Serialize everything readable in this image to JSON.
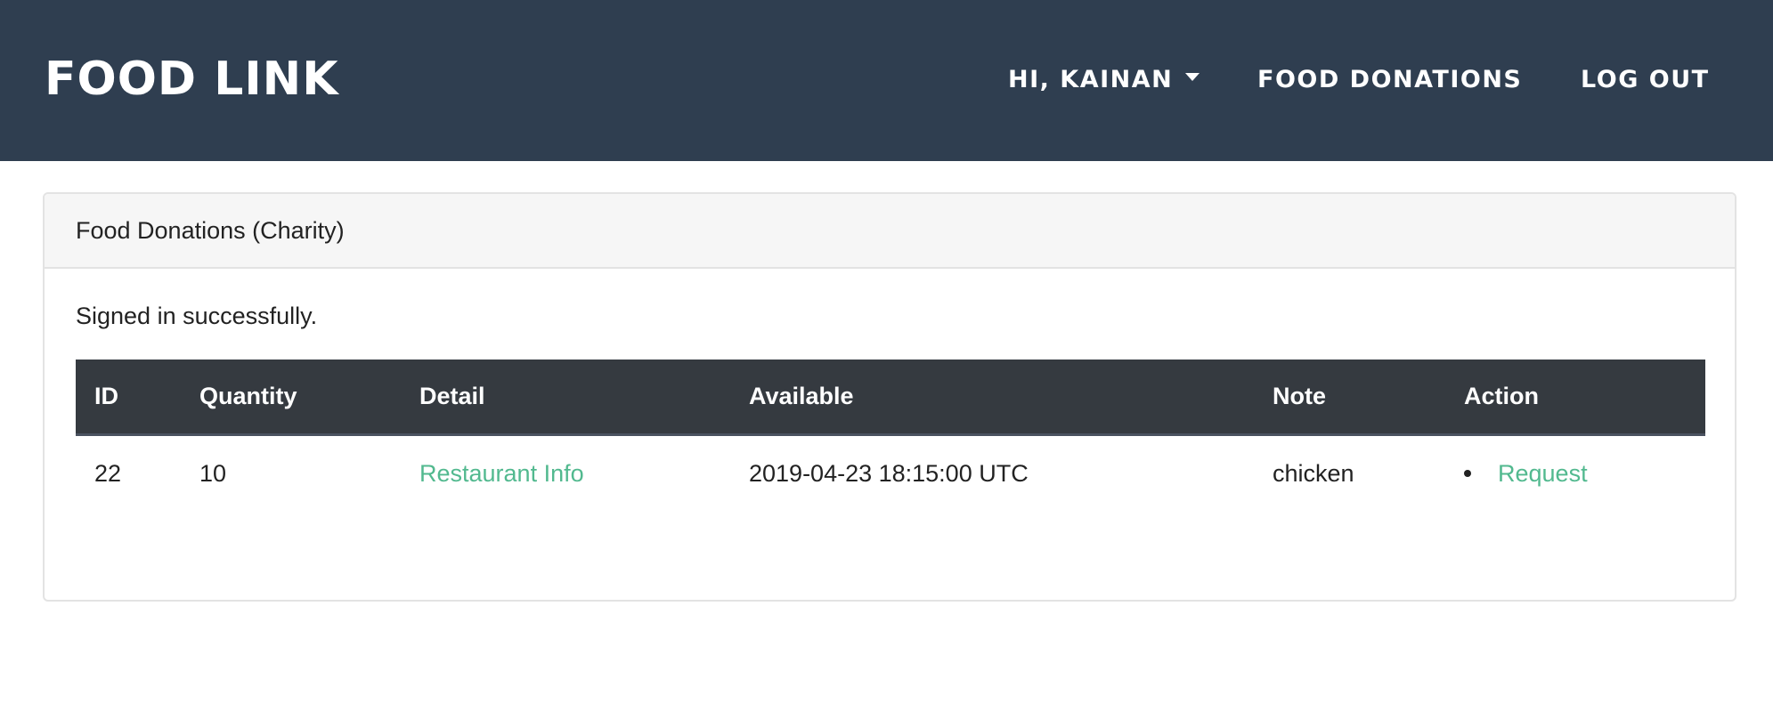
{
  "navbar": {
    "brand": "FOOD LINK",
    "user_menu_label": "HI, KAINAN",
    "donations_label": "FOOD DONATIONS",
    "logout_label": "LOG OUT",
    "background_color": "#2f3e50"
  },
  "card": {
    "title": "Food Donations (Charity)",
    "flash_message": "Signed in successfully."
  },
  "table": {
    "headers": [
      "ID",
      "Quantity",
      "Detail",
      "Available",
      "Note",
      "Action"
    ],
    "rows": [
      {
        "id": "22",
        "quantity": "10",
        "detail_link": "Restaurant Info",
        "available": "2019-04-23 18:15:00 UTC",
        "note": "chicken",
        "action_link": "Request"
      }
    ],
    "header_color": "#353a40",
    "link_color": "#52b98f"
  },
  "icons": {
    "user_menu_caret": "caret-down-icon",
    "action_bullet": "bullet-icon"
  }
}
